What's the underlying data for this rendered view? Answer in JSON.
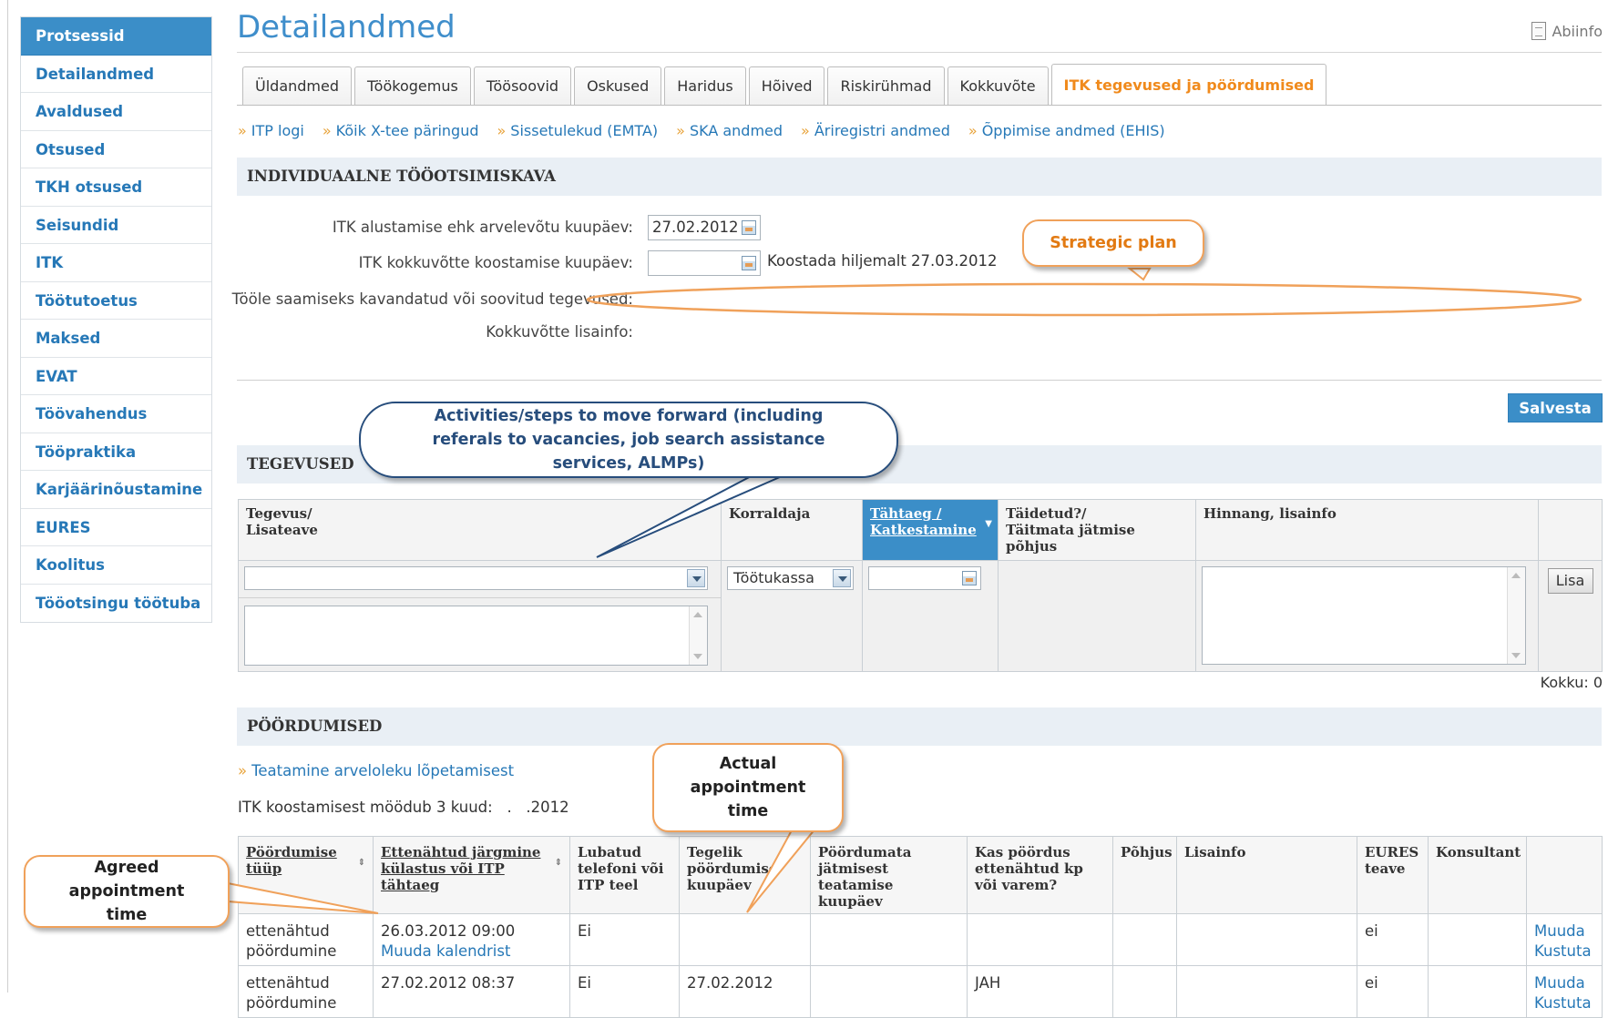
{
  "sidebar": {
    "items": [
      "Protsessid",
      "Detailandmed",
      "Avaldused",
      "Otsused",
      "TKH otsused",
      "Seisundid",
      "ITK",
      "Töötutoetus",
      "Maksed",
      "EVAT",
      "Töövahendus",
      "Tööpraktika",
      "Karjäärinõustamine",
      "EURES",
      "Koolitus",
      "Tööotsingu töötuba"
    ],
    "active": "Protsessid"
  },
  "header": {
    "title": "Detailandmed",
    "help": "Abiinfo"
  },
  "tabs": [
    "Üldandmed",
    "Töökogemus",
    "Töösoovid",
    "Oskused",
    "Haridus",
    "Hõived",
    "Riskirühmad",
    "Kokkuvõte",
    "ITK tegevused ja pöördumised"
  ],
  "sublinks": [
    "ITP logi",
    "Kõik X-tee päringud",
    "Sissetulekud (EMTA)",
    "SKA andmed",
    "Äriregistri andmed",
    "Õppimise andmed (EHIS)"
  ],
  "plan": {
    "section_title": "INDIVIDUAALNE TÖÖOTSIMISKAVA",
    "start_label": "ITK alustamise ehk arvelevõtu kuupäev:",
    "start_value": "27.02.2012",
    "summary_label": "ITK kokkuvõtte koostamise kuupäev:",
    "summary_value": "",
    "summary_hint": "Koostada hiljemalt 27.03.2012",
    "activities_label": "Tööle saamiseks kavandatud või soovitud tegevused:",
    "extra_label": "Kokkuvõtte lisainfo:"
  },
  "save_button": "Salvesta",
  "activities": {
    "section_title": "TEGEVUSED",
    "col_activity": [
      "Tegevus/",
      "Lisateave"
    ],
    "col_organizer": "Korraldaja",
    "col_deadline": [
      "Tähtaeg /",
      "Katkestamine"
    ],
    "col_done": [
      "Täidetud?/",
      "Täitmata jätmise põhjus"
    ],
    "col_rating": "Hinnang, lisainfo",
    "organizer_value": "Töötukassa",
    "add_button": "Lisa",
    "total": "Kokku: 0"
  },
  "appointments": {
    "section_title": "PÖÖRDUMISED",
    "notice_link": "Teatamine arveloleku lõpetamisest",
    "itk_note": "ITK koostamisest möödub 3 kuud:   .   .2012",
    "headers": [
      "Pöördumise tüüp",
      "Ettenähtud järgmine külastus või ITP tähtaeg",
      "Lubatud telefoni või ITP teel",
      "Tegelik pöördumise kuupäev",
      "Pöördumata jätmisest teatamise kuupäev",
      "Kas pöördus ettenähtud kp või varem?",
      "Põhjus",
      "Lisainfo",
      "EURES teave",
      "Konsultant",
      ""
    ],
    "rows": [
      {
        "type": [
          "ettenähtud",
          "pöördumine"
        ],
        "next": "26.03.2012 09:00",
        "next_link": "Muuda kalendrist",
        "phone": "Ei",
        "actual": "",
        "notify": "",
        "on_time": "",
        "reason": "",
        "info": "",
        "eures": "ei",
        "consultant": "",
        "edit": "Muuda",
        "delete": "Kustuta"
      },
      {
        "type": [
          "ettenähtud",
          "pöördumine"
        ],
        "next": "27.02.2012 08:37",
        "next_link": "",
        "phone": "Ei",
        "actual": "27.02.2012",
        "notify": "",
        "on_time": "JAH",
        "reason": "",
        "info": "",
        "eures": "ei",
        "consultant": "",
        "edit": "Muuda",
        "delete": "Kustuta"
      }
    ]
  },
  "callouts": {
    "strategic_plan": "Strategic plan",
    "activities": "Activities/steps to move forward (including referals to vacancies, job search assistance services, ALMPs)",
    "actual_time": "Actual appointment time",
    "agreed_time": "Agreed appointment time"
  },
  "colors": {
    "accent": "#3b8ec8",
    "link": "#2678b7",
    "callout": "#f0a15a",
    "callout_blue": "#274d7c",
    "active_tab": "#f08a1c"
  }
}
